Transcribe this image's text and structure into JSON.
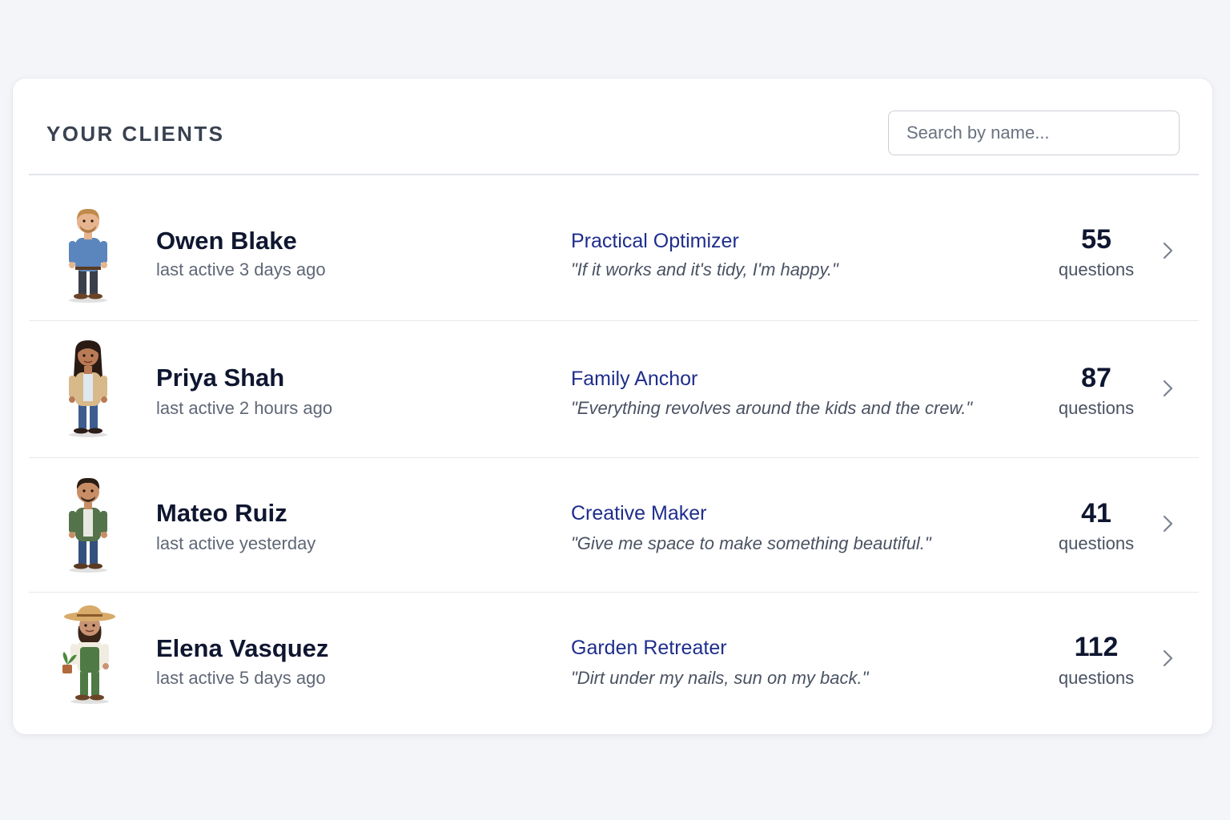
{
  "header": {
    "title": "YOUR CLIENTS",
    "search_placeholder": "Search by name..."
  },
  "clients": [
    {
      "name": "Owen Blake",
      "last_active": "last active 3 days ago",
      "persona": "Practical Optimizer",
      "quote": "\"If it works and it's tidy, I'm happy.\"",
      "count": "55",
      "count_label": "questions",
      "avatar_icon": "man-avatar-denim-shirt-icon",
      "colors": {
        "skin": "#e6b48e",
        "hair": "#c08a4a",
        "top": "#5a86bd",
        "pants": "#3b3f4a"
      }
    },
    {
      "name": "Priya Shah",
      "last_active": "last active 2 hours ago",
      "persona": "Family Anchor",
      "quote": "\"Everything revolves around the kids and the crew.\"",
      "count": "87",
      "count_label": "questions",
      "avatar_icon": "woman-avatar-tan-jacket-icon",
      "colors": {
        "skin": "#b97b56",
        "hair": "#2a1a14",
        "top": "#d8b98a",
        "pants": "#3d5d8f"
      }
    },
    {
      "name": "Mateo Ruiz",
      "last_active": "last active yesterday",
      "persona": "Creative Maker",
      "quote": "\"Give me space to make something beautiful.\"",
      "count": "41",
      "count_label": "questions",
      "avatar_icon": "man-avatar-green-shirt-icon",
      "colors": {
        "skin": "#c98e66",
        "hair": "#2b1c14",
        "top": "#55734a",
        "pants": "#34507e"
      }
    },
    {
      "name": "Elena Vasquez",
      "last_active": "last active 5 days ago",
      "persona": "Garden Retreater",
      "quote": "\"Dirt under my nails, sun on my back.\"",
      "count": "112",
      "count_label": "questions",
      "avatar_icon": "gardener-avatar-straw-hat-icon",
      "colors": {
        "skin": "#c99474",
        "hair": "#3a2418",
        "top": "#4f7a45",
        "pants": "#4f7a45"
      }
    }
  ]
}
